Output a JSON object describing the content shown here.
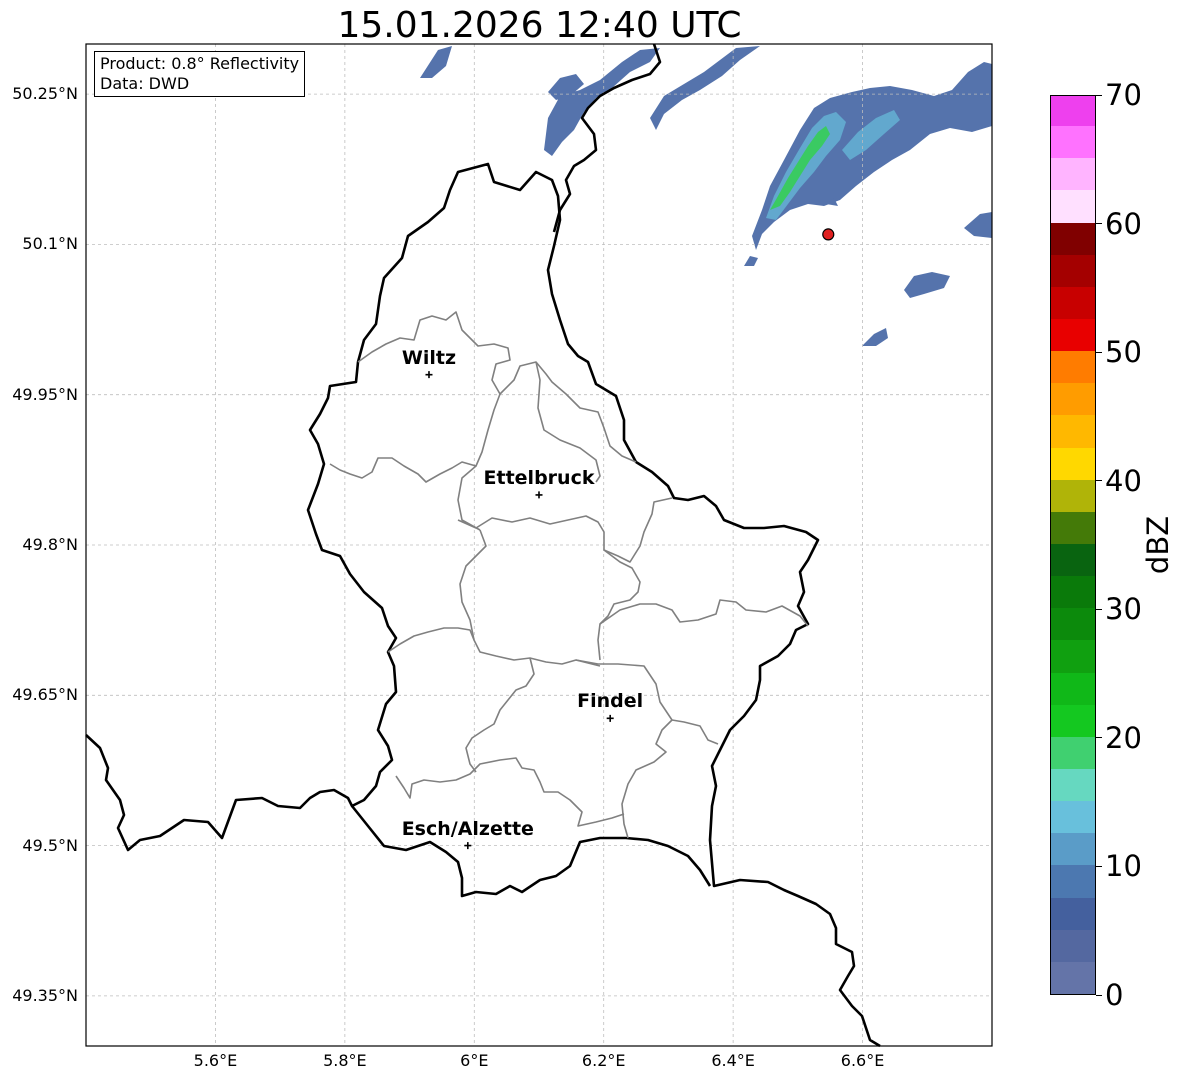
{
  "title": "15.01.2026 12:40 UTC",
  "info": {
    "product": "Product: 0.8° Reflectivity",
    "data": "Data: DWD"
  },
  "lat_ticks": [
    {
      "lat": 50.25,
      "label": "50.25°N"
    },
    {
      "lat": 50.1,
      "label": "50.1°N"
    },
    {
      "lat": 49.95,
      "label": "49.95°N"
    },
    {
      "lat": 49.8,
      "label": "49.8°N"
    },
    {
      "lat": 49.65,
      "label": "49.65°N"
    },
    {
      "lat": 49.5,
      "label": "49.5°N"
    },
    {
      "lat": 49.35,
      "label": "49.35°N"
    }
  ],
  "lon_ticks": [
    {
      "lon": 5.6,
      "label": "5.6°E"
    },
    {
      "lon": 5.8,
      "label": "5.8°E"
    },
    {
      "lon": 6.0,
      "label": "6°E"
    },
    {
      "lon": 6.2,
      "label": "6.2°E"
    },
    {
      "lon": 6.4,
      "label": "6.4°E"
    },
    {
      "lon": 6.6,
      "label": "6.6°E"
    }
  ],
  "extent": {
    "lon_min": 5.4,
    "lon_max": 6.8,
    "lat_min": 49.3,
    "lat_max": 50.3
  },
  "cities": [
    {
      "name": "Wiltz",
      "lon": 5.93,
      "lat": 49.97
    },
    {
      "name": "Ettelbruck",
      "lon": 6.1,
      "lat": 49.85
    },
    {
      "name": "Findel",
      "lon": 6.21,
      "lat": 49.627
    },
    {
      "name": "Esch/Alzette",
      "lon": 5.99,
      "lat": 49.5
    }
  ],
  "radar_site": {
    "lon": 6.547,
    "lat": 50.11,
    "color": "#e02020"
  },
  "colorbar": {
    "label": "dBZ",
    "ticks": [
      "0",
      "10",
      "20",
      "30",
      "40",
      "50",
      "60",
      "70"
    ],
    "min": 0,
    "max": 70,
    "colors": [
      "#6474a8",
      "#5468a0",
      "#44609e",
      "#4c78b0",
      "#5a9cc8",
      "#68c0dc",
      "#66d8c0",
      "#40d070",
      "#14c820",
      "#10b818",
      "#10a010",
      "#0c8a0c",
      "#0a7a0a",
      "#096410",
      "#447a08",
      "#b0b408",
      "#ffd800",
      "#ffb800",
      "#ff9c00",
      "#ff7c00",
      "#e80000",
      "#c80000",
      "#a40000",
      "#800000",
      "#ffe0ff",
      "#ffb4ff",
      "#ff72ff",
      "#ee40ee"
    ]
  }
}
